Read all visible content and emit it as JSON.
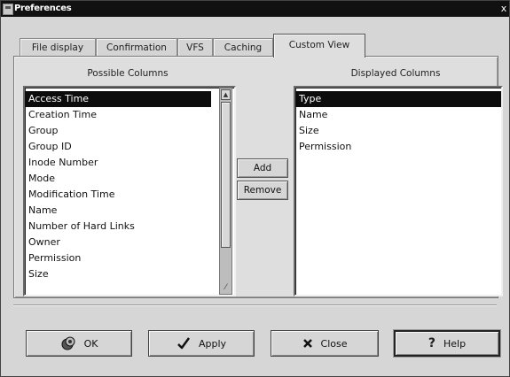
{
  "window": {
    "title": "Preferences",
    "close_glyph": "x"
  },
  "tabs": [
    {
      "label": "File display",
      "active": false
    },
    {
      "label": "Confirmation",
      "active": false
    },
    {
      "label": "VFS",
      "active": false
    },
    {
      "label": "Caching",
      "active": false
    },
    {
      "label": "Custom View",
      "active": true
    }
  ],
  "possible_columns": {
    "header": "Possible Columns",
    "selected": "Access Time",
    "items": [
      "Access Time",
      "Creation Time",
      "Group",
      "Group ID",
      "Inode Number",
      "Mode",
      "Modification Time",
      "Name",
      "Number of Hard Links",
      "Owner",
      "Permission",
      "Size"
    ]
  },
  "displayed_columns": {
    "header": "Displayed Columns",
    "selected": "Type",
    "items": [
      "Type",
      "Name",
      "Size",
      "Permission"
    ]
  },
  "actions": {
    "add_label": "Add",
    "remove_label": "Remove"
  },
  "footer": {
    "ok_label": "OK",
    "apply_label": "Apply",
    "close_label": "Close",
    "help_label": "Help"
  },
  "icons": {
    "ok": "ok-icon",
    "apply": "checkmark-icon",
    "close": "x-close-icon",
    "help": "question-mark-icon"
  },
  "colors": {
    "selection_bg": "#0c0c0c",
    "window_bg": "#d6d6d6",
    "titlebar_bg": "#111111"
  }
}
